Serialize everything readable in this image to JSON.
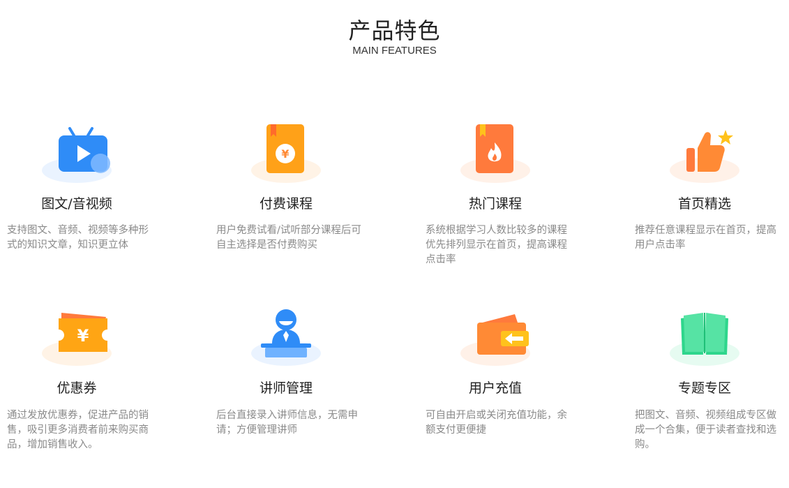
{
  "header": {
    "title": "产品特色",
    "subtitle": "MAIN FEATURES"
  },
  "features": [
    {
      "icon": "video-tv-icon",
      "title": "图文/音视频",
      "desc": "支持图文、音频、视频等多种形式的知识文章，知识更立体"
    },
    {
      "icon": "paid-course-book-icon",
      "title": "付费课程",
      "desc": "用户免费试看/试听部分课程后可自主选择是否付费购买"
    },
    {
      "icon": "hot-course-flame-book-icon",
      "title": "热门课程",
      "desc": "系统根据学习人数比较多的课程优先排列显示在首页，提高课程点击率"
    },
    {
      "icon": "thumbs-up-star-icon",
      "title": "首页精选",
      "desc": "推荐任意课程显示在首页，提高用户点击率"
    },
    {
      "icon": "coupon-ticket-icon",
      "title": "优惠券",
      "desc": "通过发放优惠券，促进产品的销售，吸引更多消费者前来购买商品，增加销售收入。"
    },
    {
      "icon": "lecturer-podium-icon",
      "title": "讲师管理",
      "desc": "后台直接录入讲师信息，无需申请；方便管理讲师"
    },
    {
      "icon": "wallet-recharge-icon",
      "title": "用户充值",
      "desc": "可自由开启或关闭充值功能，余额支付更便捷"
    },
    {
      "icon": "open-book-icon",
      "title": "专题专区",
      "desc": "把图文、音频、视频组成专区做成一个合集，便于读者查找和选购。"
    }
  ],
  "colors": {
    "blue": "#2f8cf7",
    "orange": "#ff8a35",
    "amber": "#ffa514",
    "green": "#2ed68c",
    "desc_gray": "#8a8a8a"
  }
}
